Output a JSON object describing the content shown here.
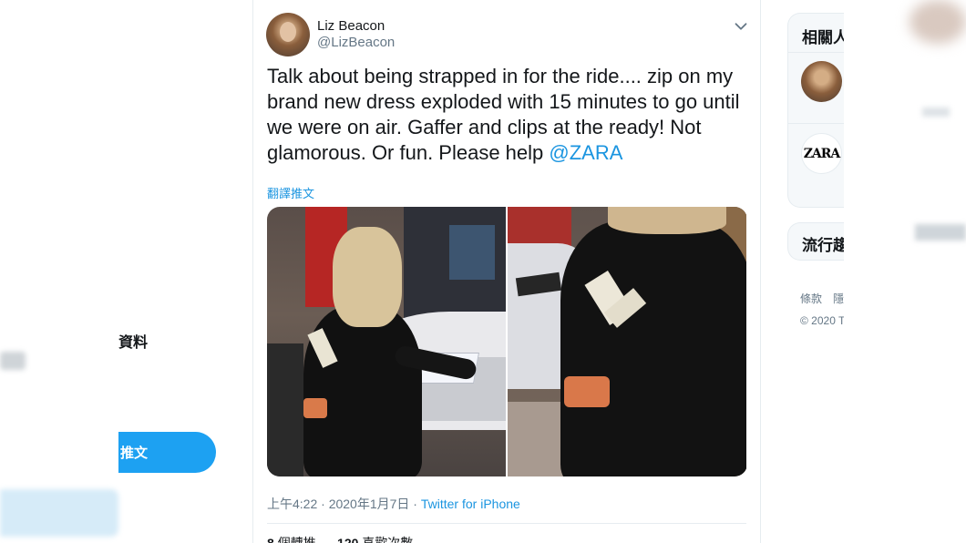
{
  "left_nav": {
    "profile_label": "資料",
    "tweet_button_label": "推文"
  },
  "tweet": {
    "display_name": "Liz Beacon",
    "handle": "@LizBeacon",
    "text": "Talk about being strapped in for the ride.... zip on my brand new dress exploded with 15 minutes to go until we were on air. Gaffer and clips at the ready! Not glamorous. Or fun. Please help ",
    "mention": "@ZARA",
    "translate_label": "翻譯推文",
    "timestamp": "上午4:22 · 2020年1月7日",
    "meta_separator": " · ",
    "source": "Twitter for iPhone",
    "stats": {
      "retweets_count": "8",
      "retweets_label": "個轉推",
      "likes_count": "120",
      "likes_label": "喜歡次數"
    }
  },
  "right_panel": {
    "related_title": "相關人",
    "trends_title": "流行趨",
    "footer_links": "條款　隱",
    "copyright": "© 2020 T",
    "related_zara_logo": "ZARA"
  },
  "icons": [
    "chevron-down-icon"
  ],
  "colors": {
    "accent": "#1da1f2",
    "link": "#1b95e0",
    "muted": "#657786"
  }
}
